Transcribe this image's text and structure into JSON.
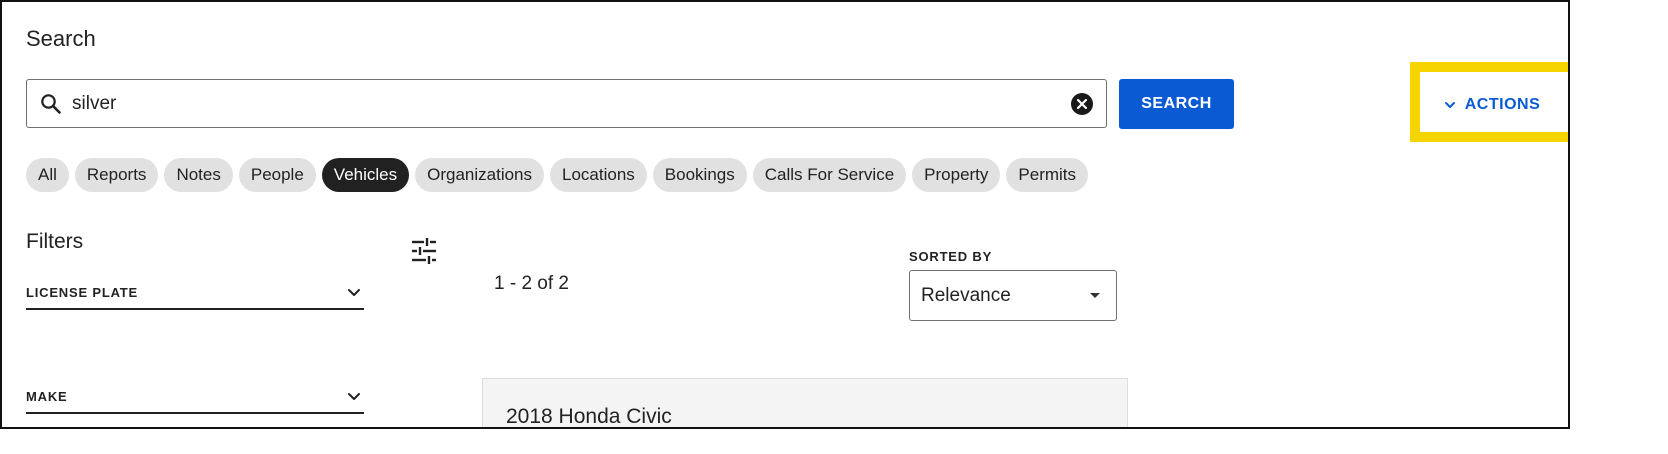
{
  "page": {
    "title": "Search"
  },
  "search": {
    "value": "silver",
    "button_label": "SEARCH",
    "search_icon": "search-icon",
    "clear_icon": "close-circle-icon"
  },
  "actions": {
    "label": "ACTIONS",
    "icon": "chevron-down-icon",
    "highlight_color": "#f5d400"
  },
  "colors": {
    "accent": "#0a5bd3",
    "active_chip": "#212121",
    "chip": "#e1e1e1"
  },
  "categories": [
    {
      "label": "All",
      "active": false
    },
    {
      "label": "Reports",
      "active": false
    },
    {
      "label": "Notes",
      "active": false
    },
    {
      "label": "People",
      "active": false
    },
    {
      "label": "Vehicles",
      "active": true
    },
    {
      "label": "Organizations",
      "active": false
    },
    {
      "label": "Locations",
      "active": false
    },
    {
      "label": "Bookings",
      "active": false
    },
    {
      "label": "Calls For Service",
      "active": false
    },
    {
      "label": "Property",
      "active": false
    },
    {
      "label": "Permits",
      "active": false
    }
  ],
  "filters": {
    "title": "Filters",
    "items": [
      {
        "label": "LICENSE PLATE"
      },
      {
        "label": "MAKE"
      }
    ]
  },
  "results": {
    "count_text": "1 - 2 of 2",
    "sorted_by_label": "SORTED BY",
    "sort_value": "Relevance",
    "items": [
      {
        "title": "2018 Honda Civic"
      }
    ]
  }
}
